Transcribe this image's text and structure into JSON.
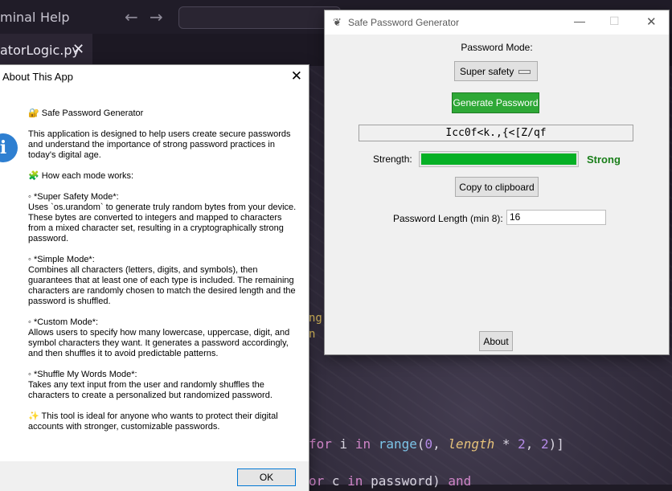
{
  "editor": {
    "menu": [
      "minal",
      "Help"
    ],
    "active_tab": "atorLogic.py",
    "tab_close": "✕",
    "code_fragment_1": "ng.",
    "code_fragment_2": "n",
    "code_line_1": {
      "kw_for": "for",
      "var_i": " i ",
      "kw_in": "in",
      "fn_range": " range",
      "open": "(",
      "zero": "0",
      "comma1": ", ",
      "length": "length",
      "times": " * ",
      "two1": "2",
      "comma2": ", ",
      "two2": "2",
      "close": ")]"
    },
    "code_line_2": {
      "kw_or": "or",
      "var_c": " c ",
      "kw_in": "in",
      "rest": " password) ",
      "kw_and": "and"
    }
  },
  "about_dialog": {
    "title": "About This App",
    "close_glyph": "✕",
    "icon": "info-icon",
    "icon_glyph": "i",
    "app_name": "🔐 Safe Password Generator",
    "intro": "This application is designed to help users create secure passwords and understand the importance of strong password practices in today's digital age.",
    "how_heading": "🧩 How each mode works:",
    "modes": [
      {
        "heading": "◦  *Super Safety Mode*:",
        "text": "Uses `os.urandom` to generate truly random bytes from your device. These bytes are converted to integers and mapped to characters from a mixed character set, resulting in a cryptographically strong password."
      },
      {
        "heading": "◦  *Simple Mode*:",
        "text": "Combines all characters (letters, digits, and symbols), then guarantees that at least one of each type is included. The remaining characters are randomly chosen to match the desired length and the password is shuffled."
      },
      {
        "heading": "◦  *Custom Mode*:",
        "text": "Allows users to specify how many lowercase, uppercase, digit, and symbol characters they want. It generates a password accordingly, and then shuffles it to avoid predictable patterns."
      },
      {
        "heading": "◦  *Shuffle My Words Mode*:",
        "text": "Takes any text input from the user and randomly shuffles the characters to create a personalized but randomized password."
      }
    ],
    "closing": "✨ This tool is ideal for anyone who wants to protect their digital accounts with stronger, customizable passwords.",
    "ok_label": "OK"
  },
  "generator": {
    "title": "Safe Password Generator",
    "feather_glyph": "❦",
    "controls": {
      "minimize": "—",
      "maximize": "☐",
      "close": "✕"
    },
    "mode_label": "Password Mode:",
    "mode_value": "Super safety",
    "generate_label": "Generate Password",
    "password": "Icc0f<k.,{<[Z/qf",
    "strength_label": "Strength:",
    "strength_fraction": 1.0,
    "strength_text": "Strong",
    "copy_label": "Copy to clipboard",
    "length_label": "Password Length (min 8):",
    "length_value": "16",
    "about_label": "About"
  },
  "colors": {
    "generate_bg": "#2ea836",
    "strength_fill": "#06b025",
    "strength_text": "#1a7f1a",
    "info_icon": "#2e7fd1"
  }
}
